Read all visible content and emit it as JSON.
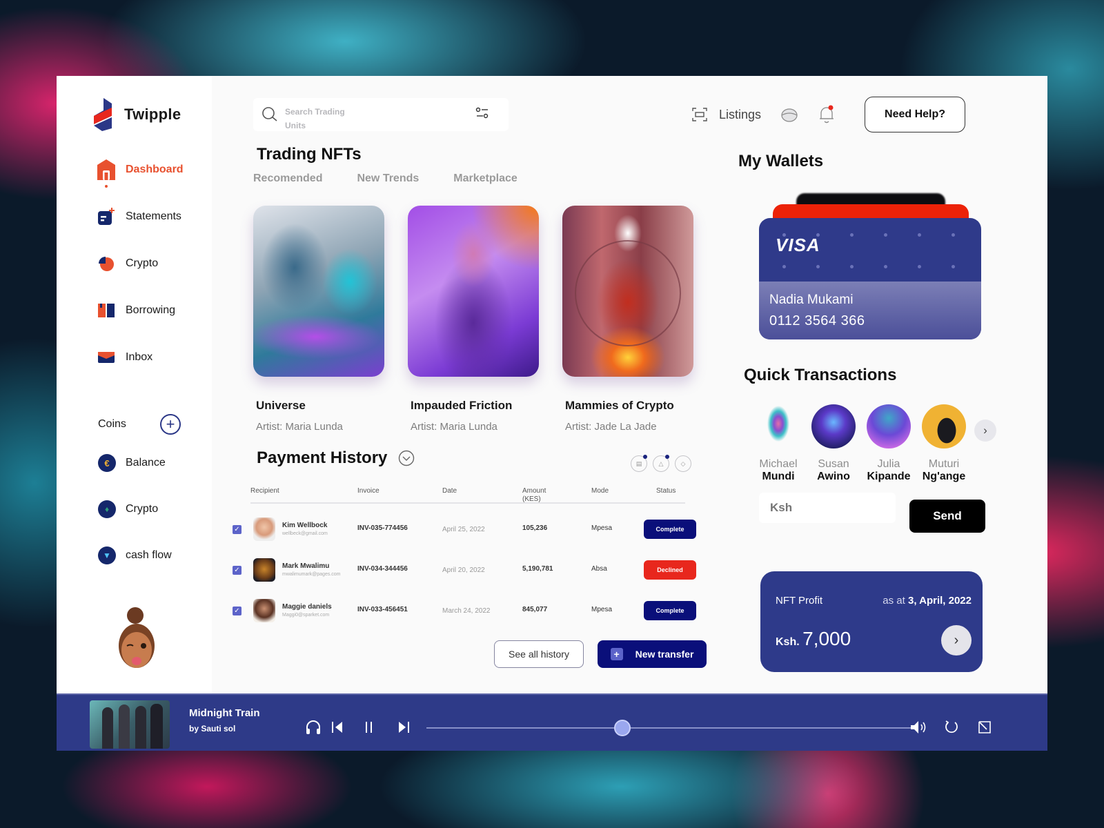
{
  "app": {
    "name": "Twipple"
  },
  "sidebar": {
    "items": [
      {
        "label": "Dashboard",
        "icon": "home-icon",
        "active": true
      },
      {
        "label": "Statements",
        "icon": "statement-icon",
        "active": false
      },
      {
        "label": "Crypto",
        "icon": "pie-chart-icon",
        "active": false
      },
      {
        "label": "Borrowing",
        "icon": "book-icon",
        "active": false
      },
      {
        "label": "Inbox",
        "icon": "mail-icon",
        "active": false
      }
    ],
    "coins_label": "Coins",
    "coins": [
      {
        "label": "Balance",
        "icon": "euro-coin-icon"
      },
      {
        "label": "Crypto",
        "icon": "ethereum-coin-icon"
      },
      {
        "label": "cash flow",
        "icon": "triangle-coin-icon"
      }
    ]
  },
  "header": {
    "search_placeholder": "Search Trading Units",
    "listings_label": "Listings",
    "help_label": "Need Help?",
    "notification_dot_color": "#e8271d"
  },
  "trading": {
    "title": "Trading NFTs",
    "tabs": [
      "Recomended",
      "New Trends",
      "Marketplace"
    ],
    "nfts": [
      {
        "title": "Universe",
        "artist": "Artist: Maria Lunda"
      },
      {
        "title": "Impauded Friction",
        "artist": "Artist: Maria Lunda"
      },
      {
        "title": "Mammies of Crypto",
        "artist": "Artist: Jade La Jade"
      }
    ]
  },
  "payments": {
    "title": "Payment History",
    "columns": [
      "Recipient",
      "Invoice",
      "Date",
      "Amount (KES)",
      "Mode",
      "Status"
    ],
    "rows": [
      {
        "name": "Kim Wellbock",
        "email": "wellbeck@gmail.com",
        "invoice": "INV-035-774456",
        "date": "April 25, 2022",
        "amount": "105,236",
        "mode": "Mpesa",
        "status": "Complete",
        "checked": true
      },
      {
        "name": "Mark Mwalimu",
        "email": "mwalimumark@pages.com",
        "invoice": "INV-034-344456",
        "date": "April 20, 2022",
        "amount": "5,190,781",
        "mode": "Absa",
        "status": "Declined",
        "checked": true
      },
      {
        "name": "Maggie daniels",
        "email": "Maggi0@sparket.com",
        "invoice": "INV-033-456451",
        "date": "March 24, 2022",
        "amount": "845,077",
        "mode": "Mpesa",
        "status": "Complete",
        "checked": true
      }
    ],
    "see_all_label": "See all history",
    "new_transfer_label": "New transfer",
    "status_colors": {
      "Complete": "#0a0f7a",
      "Declined": "#e8271d"
    }
  },
  "wallet": {
    "title": "My Wallets",
    "card": {
      "brand": "VISA",
      "holder": "Nadia Mukami",
      "number": "0112 3564 366"
    }
  },
  "quick": {
    "title": "Quick Transactions",
    "people": [
      {
        "first": "Michael",
        "last": "Mundi"
      },
      {
        "first": "Susan",
        "last": "Awino"
      },
      {
        "first": "Julia",
        "last": "Kipande"
      },
      {
        "first": "Muturi",
        "last": "Ng'ange"
      }
    ],
    "amount_placeholder": "Ksh",
    "send_label": "Send"
  },
  "profit": {
    "label": "NFT Profit",
    "as_at_prefix": "as at",
    "as_at_date": "3, April, 2022",
    "currency": "Ksh.",
    "amount": "7,000"
  },
  "player": {
    "song": "Midnight Train",
    "artist": "by Sauti sol",
    "progress_percent": 40
  }
}
